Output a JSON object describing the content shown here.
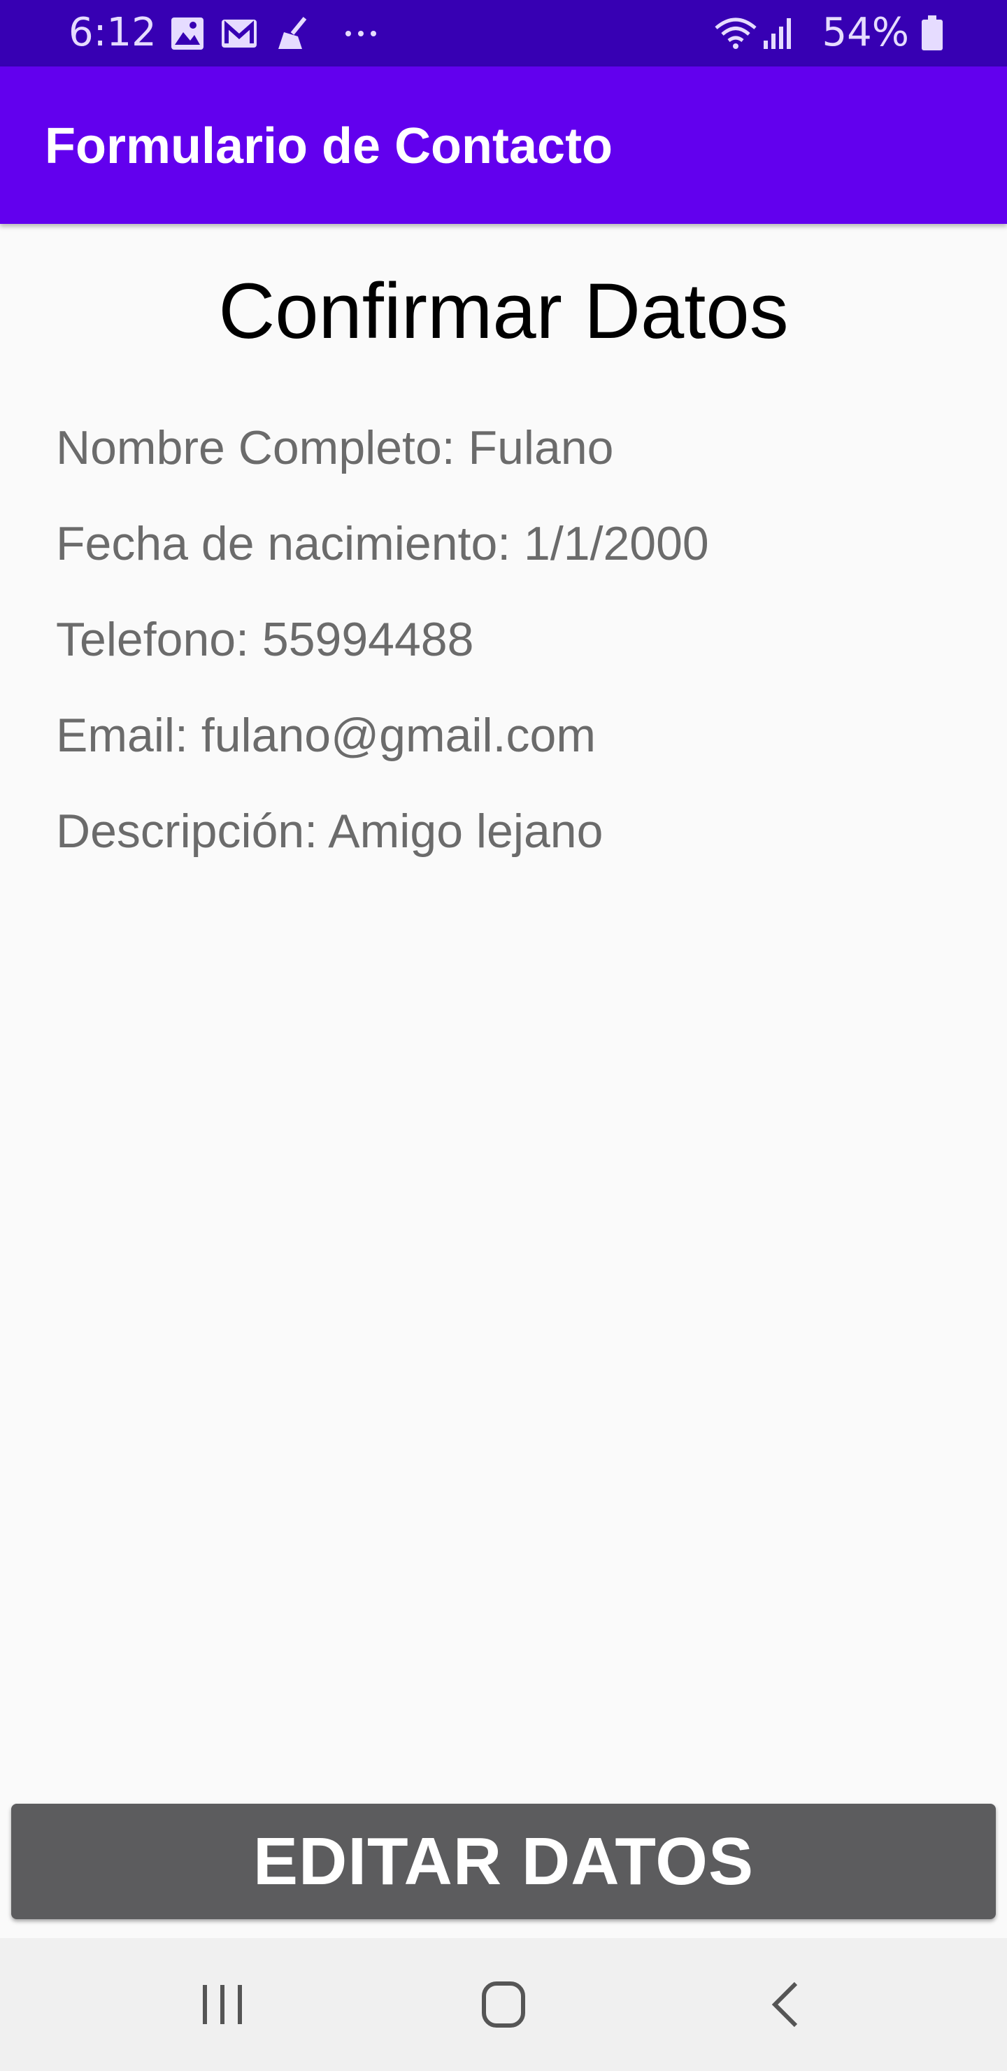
{
  "status_bar": {
    "time": "6:12",
    "battery_percent": "54%",
    "left_icons": [
      "image-icon",
      "gmail-icon",
      "cleaner-icon",
      "more-dots-icon"
    ],
    "right_icons": [
      "wifi-icon",
      "signal-icon",
      "battery-icon"
    ],
    "color": "#3700b3"
  },
  "app_bar": {
    "title": "Formulario de Contacto",
    "color": "#6200ee"
  },
  "main": {
    "heading": "Confirmar Datos",
    "details": [
      "Nombre Completo: Fulano",
      "Fecha de nacimiento: 1/1/2000",
      "Telefono: 55994488",
      "Email: fulano@gmail.com",
      "Descripción: Amigo lejano"
    ]
  },
  "actions": {
    "edit_label": "EDITAR DATOS",
    "button_color": "#5c5c5e"
  },
  "nav_bar": {
    "buttons": [
      "recent-apps-icon",
      "home-icon",
      "back-icon"
    ]
  }
}
